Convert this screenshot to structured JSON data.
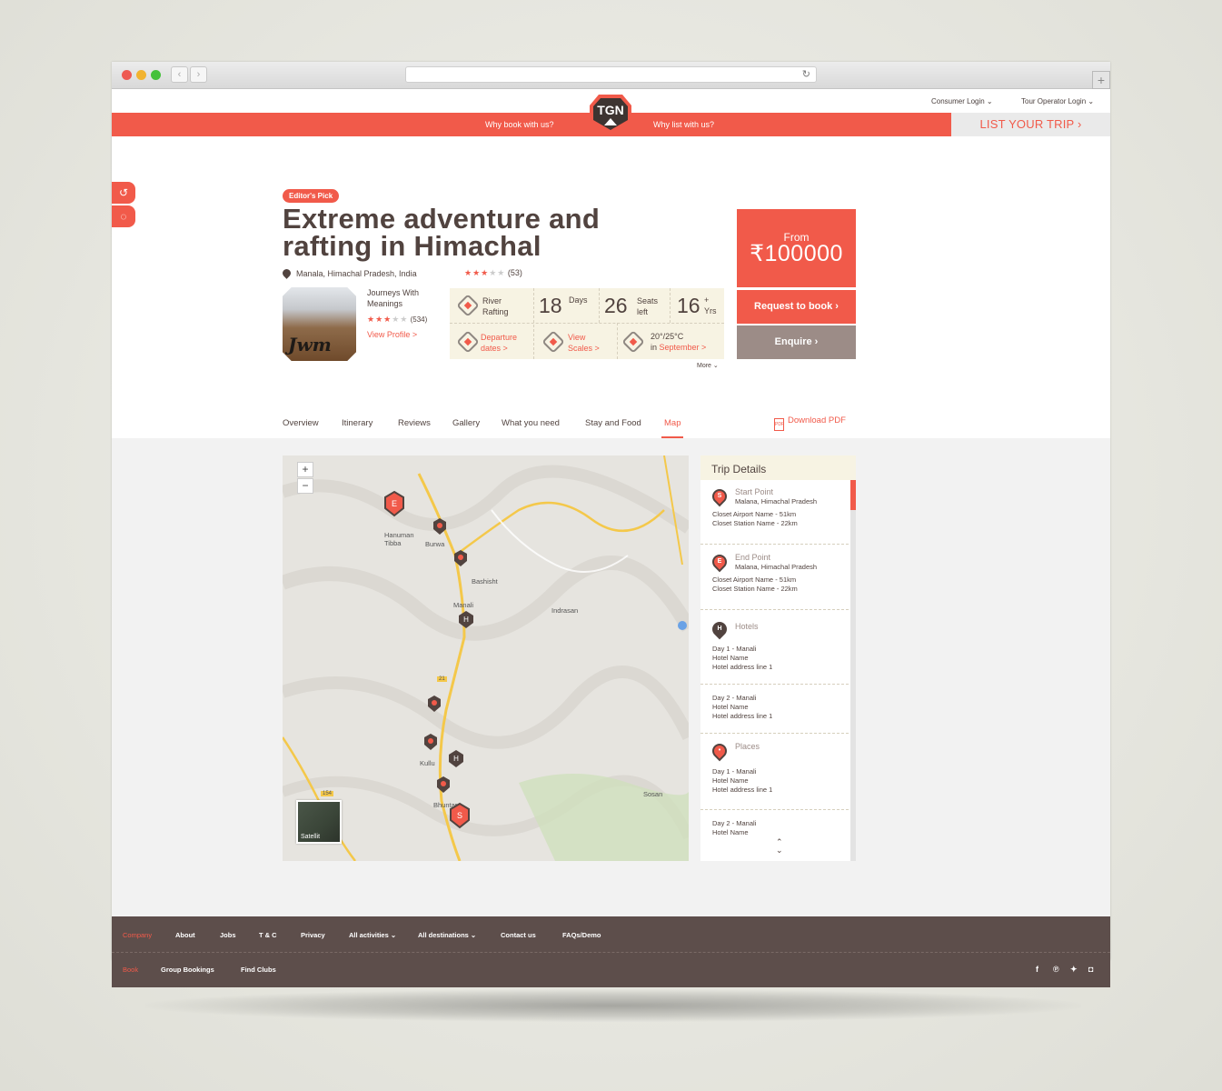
{
  "header": {
    "consumer_login": "Consumer Login",
    "operator_login": "Tour Operator Login",
    "why_book": "Why book with us?",
    "why_list": "Why list with us?",
    "logo_text": "TGN",
    "list_trip": "LIST YOUR TRIP"
  },
  "trip": {
    "badge": "Editor's Pick",
    "title": "Extreme adventure and rafting in Himachal",
    "location": "Manala, Himachal Pradesh, India",
    "rating_count": "(53)",
    "rating_stars": 3
  },
  "operator": {
    "name": "Journeys With Meanings",
    "rating_count": "(534)",
    "view_profile": "View Profile >",
    "img_text": "Jwm"
  },
  "info": {
    "activity_label": "River Rafting",
    "days": "18",
    "days_label": "Days",
    "seats": "26",
    "seats_label": "Seats left",
    "age": "16",
    "age_label": "+ Yrs",
    "departure": "Departure dates >",
    "view_scales": "View Scales >",
    "temp": "20°/25°C",
    "temp_in": "in",
    "temp_month": "September >",
    "more": "More"
  },
  "price": {
    "from": "From",
    "amount": "₹100000",
    "request": "Request to book",
    "enquire": "Enquire"
  },
  "tabs": [
    "Overview",
    "Itinerary",
    "Reviews",
    "Gallery",
    "What you need",
    "Stay and Food",
    "Map"
  ],
  "download_pdf": "Download PDF",
  "map": {
    "zoom_in": "+",
    "zoom_out": "−",
    "satellite": "Satellit",
    "labels": [
      "Hanuman Tibba",
      "Burwa",
      "Bashisht",
      "Manali",
      "Indrasan",
      "Kullu",
      "Bhuntar",
      "Sosan",
      "21",
      "154"
    ]
  },
  "trip_details": {
    "title": "Trip Details",
    "start_title": "Start Point",
    "start_place": "Malana, Himachal Pradesh",
    "end_title": "End Point",
    "end_place": "Malana, Himachal Pradesh",
    "airport": "Closet Airport Name - 51km",
    "station": "Closet Station Name - 22km",
    "hotels_title": "Hotels",
    "places_title": "Places",
    "day1": "Day 1 - Manali",
    "day2": "Day 2 - Manali",
    "hotel_name": "Hotel Name",
    "hotel_address": "Hotel address line 1"
  },
  "footer": {
    "company": "Company",
    "row1": [
      "About",
      "Jobs",
      "T & C",
      "Privacy",
      "All activities",
      "All destinations",
      "Contact us",
      "FAQs/Demo"
    ],
    "book": "Book",
    "row2": [
      "Group Bookings",
      "Find Clubs"
    ]
  },
  "colors": {
    "accent": "#f15a4a",
    "dark": "#5d4e4b",
    "cream": "#f7f3e3",
    "enquire": "#9c8c87"
  }
}
